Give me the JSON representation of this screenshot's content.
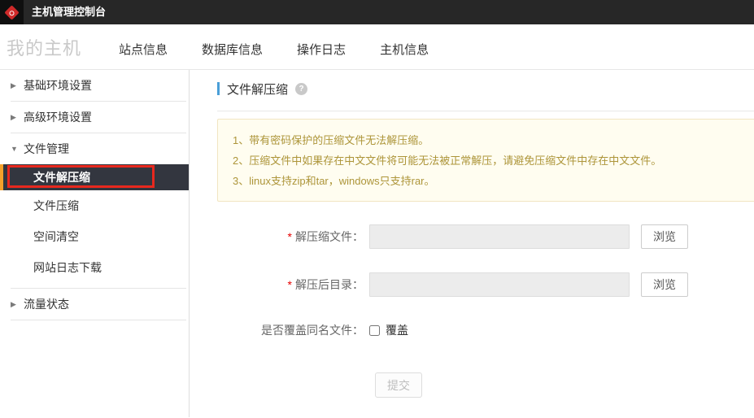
{
  "topbar": {
    "title": "主机管理控制台"
  },
  "nav": {
    "active_tab": "我的主机",
    "tabs": [
      "站点信息",
      "数据库信息",
      "操作日志",
      "主机信息"
    ]
  },
  "sidebar": {
    "groups": [
      {
        "label": "基础环境设置",
        "state": "collapsed"
      },
      {
        "label": "高级环境设置",
        "state": "collapsed"
      },
      {
        "label": "文件管理",
        "state": "expanded"
      },
      {
        "label": "流量状态",
        "state": "collapsed"
      }
    ],
    "file_management_items": [
      {
        "label": "文件解压缩",
        "selected": true
      },
      {
        "label": "文件压缩",
        "selected": false
      },
      {
        "label": "空间清空",
        "selected": false
      },
      {
        "label": "网站日志下载",
        "selected": false
      }
    ],
    "collapsed_marker": "▶",
    "expanded_marker": "▼"
  },
  "main": {
    "title": "文件解压缩",
    "help_icon_glyph": "?",
    "notices": [
      "1、带有密码保护的压缩文件无法解压缩。",
      "2、压缩文件中如果存在中文文件将可能无法被正常解压，请避免压缩文件中存在中文文件。",
      "3、linux支持zip和tar，windows只支持rar。"
    ],
    "form": {
      "required_mark": "*",
      "fields": [
        {
          "label": "解压缩文件：",
          "value": "",
          "browse_label": "浏览"
        },
        {
          "label": "解压后目录：",
          "value": "",
          "browse_label": "浏览"
        }
      ],
      "overwrite_label": "是否覆盖同名文件：",
      "overwrite_option": "覆盖",
      "overwrite_checked": false,
      "submit_label": "提交"
    }
  },
  "colors": {
    "topbar_bg": "#272727",
    "selected_item_bg": "#33363f",
    "selected_item_accent": "#f5a12b",
    "annotation_red": "#e8281e",
    "title_accent_blue": "#4a9fd8",
    "notice_bg": "#fffdf0",
    "notice_border": "#f1e5c2",
    "notice_text": "#ad9539",
    "required_red": "#e60000"
  }
}
